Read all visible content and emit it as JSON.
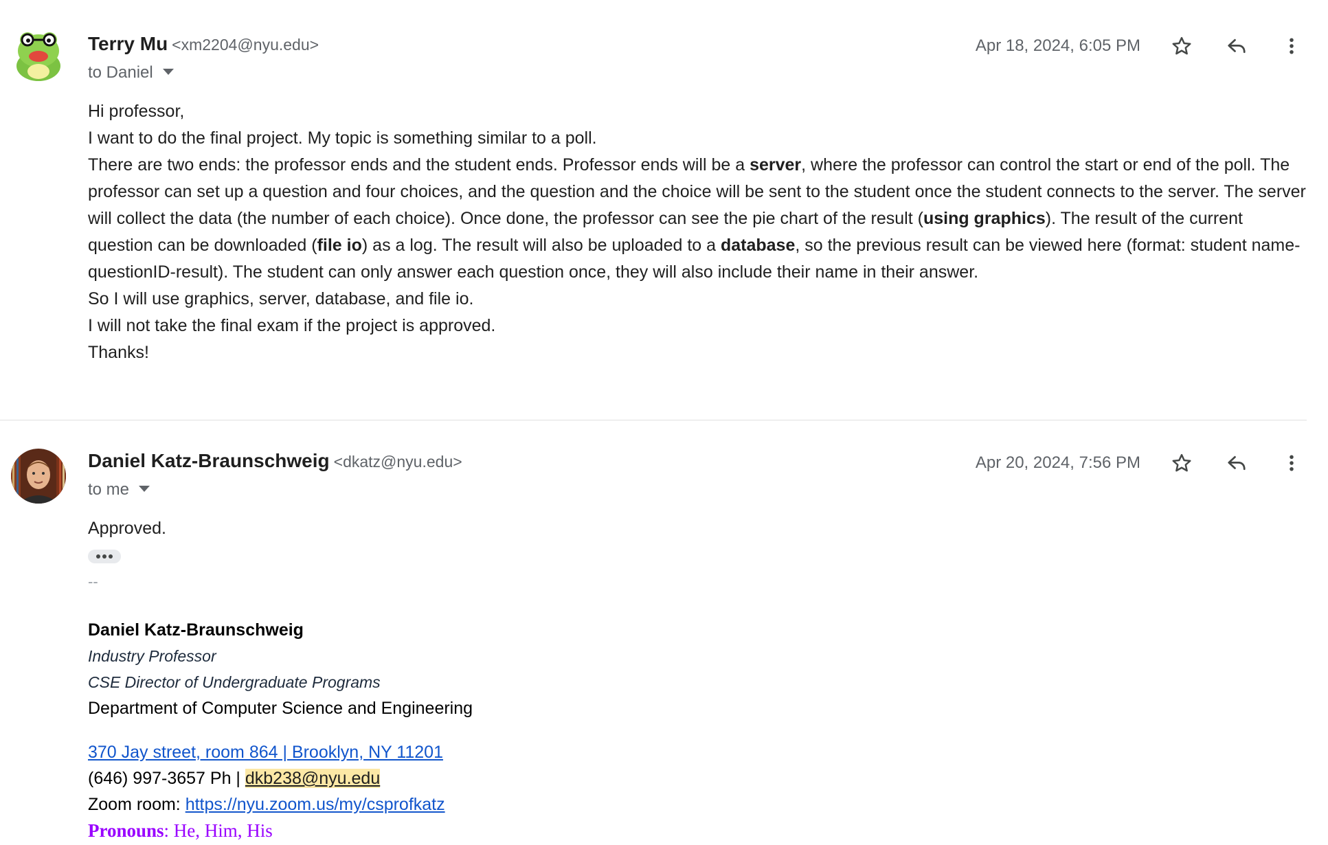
{
  "messages": [
    {
      "sender_name": "Terry Mu",
      "sender_email": "<xm2204@nyu.edu>",
      "to": "to Daniel",
      "date": "Apr 18, 2024, 6:05 PM",
      "paragraphs": {
        "p1": "Hi professor,",
        "p2": "I want to do the final project. My topic is something similar to a poll.",
        "p3a": "There are two ends: the professor ends and the student ends. Professor ends will be a ",
        "p3b": "server",
        "p3c": ", where the professor can control the start or end of the poll. The professor can set up a question and four choices, and the question and the choice will be sent to the student once the student connects to the server. The server will collect the data (the number of each choice). Once done, the professor can see the pie chart of the result (",
        "p3d": "using graphics",
        "p3e": "). The result of the current question can be downloaded (",
        "p3f": "file io",
        "p3g": ") as a log. The result will also be uploaded to a ",
        "p3h": "database",
        "p3i": ", so the previous result can be viewed here (format: student name-questionID-result). The student can only answer each question once, they will also include their name in their answer.",
        "p4": "So I will use graphics, server, database, and file io.",
        "p5": "I will not take the final exam if the project is approved.",
        "p6": "Thanks!"
      }
    },
    {
      "sender_name": "Daniel Katz-Braunschweig",
      "sender_email": "<dkatz@nyu.edu>",
      "to": "to me",
      "date": "Apr 20, 2024, 7:56 PM",
      "body": "Approved.",
      "signature": {
        "dash": "--",
        "name": "Daniel Katz-Braunschweig",
        "title1": "Industry Professor",
        "title2": "CSE Director of Undergraduate Programs",
        "dept": "Department of Computer Science and Engineering",
        "address": "370 Jay street, room 864 | Brooklyn, NY 11201",
        "phone": "(646) 997-3657 Ph | ",
        "email": "dkb238@nyu.edu",
        "zoom_label": "Zoom room: ",
        "zoom_link": "https://nyu.zoom.us/my/csprofkatz",
        "pronouns_label": "Pronouns",
        "pronouns_value": ": He, Him, His"
      }
    }
  ],
  "icons": {
    "star": "star-icon",
    "reply": "reply-icon",
    "more": "more-vert-icon"
  }
}
